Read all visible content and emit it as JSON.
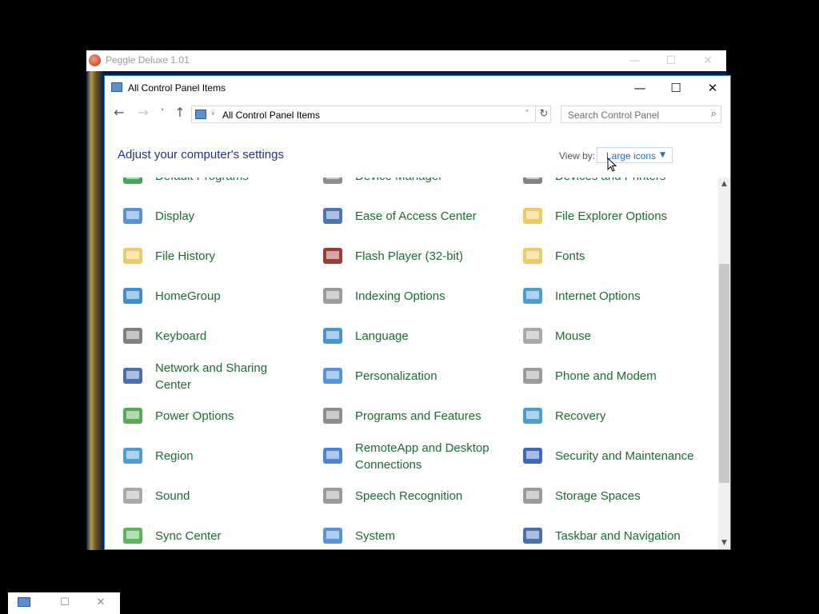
{
  "peggle": {
    "title": "Peggle Deluxe 1.01",
    "min": "—",
    "max": "☐",
    "close": "✕"
  },
  "window": {
    "title": "All Control Panel Items",
    "min": "—",
    "max": "☐",
    "close": "✕"
  },
  "nav": {
    "back": "←",
    "forward": "→",
    "recent": "˅",
    "up": "↑"
  },
  "address": {
    "path": "All Control Panel Items",
    "separator": "›",
    "dropdown": "˅",
    "refresh": "↻"
  },
  "search": {
    "placeholder": "Search Control Panel",
    "icon": "⌕"
  },
  "heading": "Adjust your computer's settings",
  "view_by": {
    "label": "View by:",
    "value": "Large icons",
    "caret": "▼"
  },
  "items": [
    {
      "label": "Default Programs",
      "icon": "default-programs-icon",
      "color": "#1a9a3a"
    },
    {
      "label": "Device Manager",
      "icon": "device-manager-icon",
      "color": "#7a7a7a"
    },
    {
      "label": "Devices and Printers",
      "icon": "devices-printers-icon",
      "color": "#6d6d6d"
    },
    {
      "label": "Display",
      "icon": "display-icon",
      "color": "#3b7fd0"
    },
    {
      "label": "Ease of Access Center",
      "icon": "ease-of-access-icon",
      "color": "#2c5ca8"
    },
    {
      "label": "File Explorer Options",
      "icon": "file-explorer-options-icon",
      "color": "#e8c24a"
    },
    {
      "label": "File History",
      "icon": "file-history-icon",
      "color": "#e8c24a"
    },
    {
      "label": "Flash Player (32-bit)",
      "icon": "flash-player-icon",
      "color": "#8c1a12"
    },
    {
      "label": "Fonts",
      "icon": "fonts-icon",
      "color": "#e8c24a"
    },
    {
      "label": "HomeGroup",
      "icon": "homegroup-icon",
      "color": "#1f7ac4"
    },
    {
      "label": "Indexing Options",
      "icon": "indexing-options-icon",
      "color": "#8a8a8a"
    },
    {
      "label": "Internet Options",
      "icon": "internet-options-icon",
      "color": "#2d8cc9"
    },
    {
      "label": "Keyboard",
      "icon": "keyboard-icon",
      "color": "#6a6a6a"
    },
    {
      "label": "Language",
      "icon": "language-icon",
      "color": "#2d7fd0"
    },
    {
      "label": "Mouse",
      "icon": "mouse-icon",
      "color": "#9a9a9a"
    },
    {
      "label": "Network and Sharing\nCenter",
      "icon": "network-sharing-icon",
      "color": "#2b57a0"
    },
    {
      "label": "Personalization",
      "icon": "personalization-icon",
      "color": "#3b7fd0"
    },
    {
      "label": "Phone and Modem",
      "icon": "phone-modem-icon",
      "color": "#8a8a8a"
    },
    {
      "label": "Power Options",
      "icon": "power-options-icon",
      "color": "#3c9a3c"
    },
    {
      "label": "Programs and Features",
      "icon": "programs-features-icon",
      "color": "#7a7a7a"
    },
    {
      "label": "Recovery",
      "icon": "recovery-icon",
      "color": "#2d8cc9"
    },
    {
      "label": "Region",
      "icon": "region-icon",
      "color": "#2d8cc9"
    },
    {
      "label": "RemoteApp and Desktop\nConnections",
      "icon": "remoteapp-icon",
      "color": "#2d6fc9"
    },
    {
      "label": "Security and Maintenance",
      "icon": "security-maintenance-icon",
      "color": "#1e4fae"
    },
    {
      "label": "Sound",
      "icon": "sound-icon",
      "color": "#9a9a9a"
    },
    {
      "label": "Speech Recognition",
      "icon": "speech-recognition-icon",
      "color": "#8a8a8a"
    },
    {
      "label": "Storage Spaces",
      "icon": "storage-spaces-icon",
      "color": "#8a8a8a"
    },
    {
      "label": "Sync Center",
      "icon": "sync-center-icon",
      "color": "#3caa3c"
    },
    {
      "label": "System",
      "icon": "system-icon",
      "color": "#3b7fd0"
    },
    {
      "label": "Taskbar and Navigation",
      "icon": "taskbar-navigation-icon",
      "color": "#2b57a0"
    }
  ],
  "scrollbar": {
    "up": "▲",
    "down": "▼"
  },
  "mini": {
    "max": "☐",
    "close": "✕"
  }
}
